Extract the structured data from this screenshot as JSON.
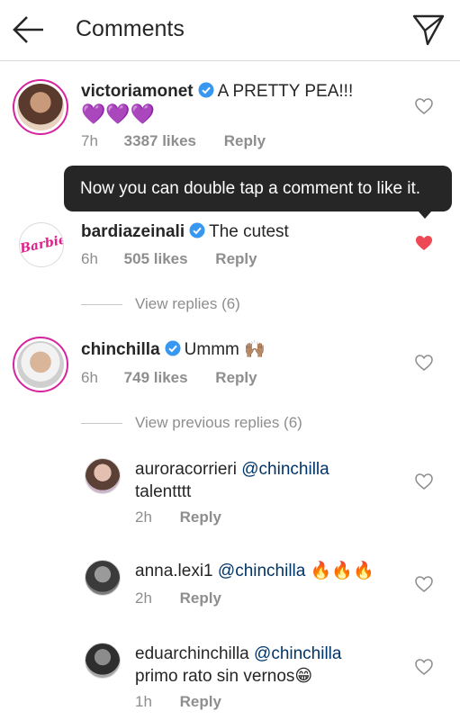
{
  "header": {
    "title": "Comments",
    "back_icon": "arrow-left-icon",
    "send_icon": "paper-plane-icon"
  },
  "tooltip": {
    "text": "Now you can double tap a comment to like it."
  },
  "colors": {
    "liked_heart": "#ed4956",
    "verified": "#3897f0",
    "mention": "#003569",
    "story_ring": "#d6249f",
    "purple_heart": "#7b3fd1"
  },
  "comments": [
    {
      "username": "victoriamonet",
      "verified": true,
      "text": "A PRETTY PEA!!!",
      "emoji": "💜💜💜",
      "time": "7h",
      "likes": "3387 likes",
      "reply": "Reply",
      "liked": false
    },
    {
      "username": "bardiazeinali",
      "verified": true,
      "text": "The cutest",
      "time": "6h",
      "likes": "505 likes",
      "reply": "Reply",
      "liked": true,
      "avatar_text": "Barbie",
      "view_replies": "View replies (6)"
    },
    {
      "username": "chinchilla",
      "verified": true,
      "text": "Ummm",
      "emoji": "🙌🏽",
      "time": "6h",
      "likes": "749 likes",
      "reply": "Reply",
      "liked": false,
      "view_replies": "View previous replies (6)"
    }
  ],
  "replies": [
    {
      "username": "auroracorrieri",
      "mention": "@chinchilla",
      "text": "talentttt",
      "time": "2h",
      "reply": "Reply"
    },
    {
      "username": "anna.lexi1",
      "mention": "@chinchilla",
      "emoji": "🔥🔥🔥",
      "time": "2h",
      "reply": "Reply"
    },
    {
      "username": "eduarchinchilla",
      "mention": "@chinchilla",
      "text": "primo rato sin vernos",
      "emoji": "😁",
      "time": "1h",
      "reply": "Reply"
    }
  ]
}
